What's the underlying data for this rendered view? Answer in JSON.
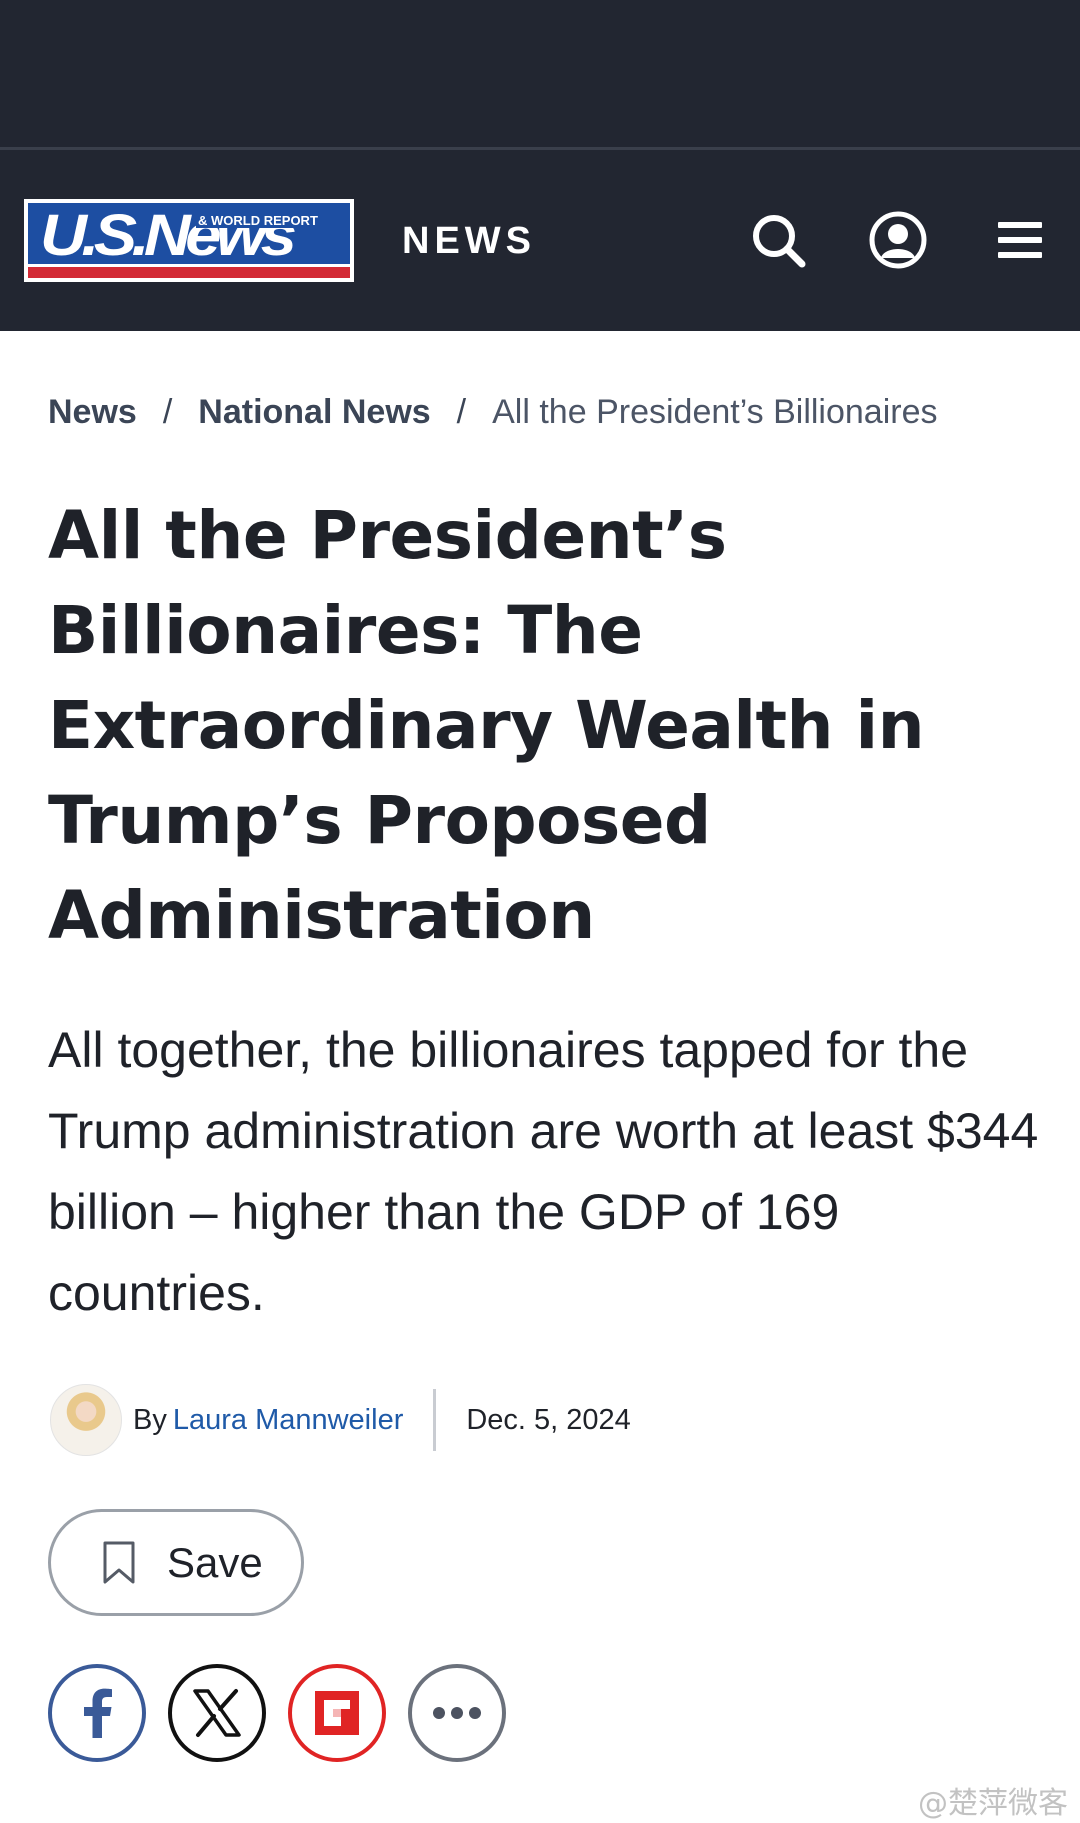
{
  "header": {
    "logo_main": "U.S.News",
    "logo_sub": "& WORLD REPORT",
    "section_label": "NEWS",
    "icons": [
      "search-icon",
      "account-icon",
      "menu-icon"
    ]
  },
  "breadcrumb": {
    "items": [
      "News",
      "National News"
    ],
    "separator": "/",
    "current": "All the President’s Billionaires"
  },
  "article": {
    "headline": "All the President’s Billionaires: The Extraordinary Wealth in Trump’s Proposed Administration",
    "dek": "All together, the billionaires tapped for the Trump administration are worth at least $344 billion – higher than the GDP of 169 countries.",
    "byline": {
      "prefix": "By",
      "author": "Laura Mannweiler",
      "date": "Dec. 5, 2024"
    }
  },
  "actions": {
    "save_label": "Save",
    "share": [
      "facebook-icon",
      "x-icon",
      "flipboard-icon",
      "more-icon"
    ]
  },
  "watermark": "@楚萍微客",
  "colors": {
    "header_bg": "#222631",
    "logo_blue": "#1d4ea2",
    "logo_red": "#d32a35",
    "author_link": "#1f5aa8",
    "facebook": "#3a5a98",
    "flipboard": "#e02424"
  }
}
